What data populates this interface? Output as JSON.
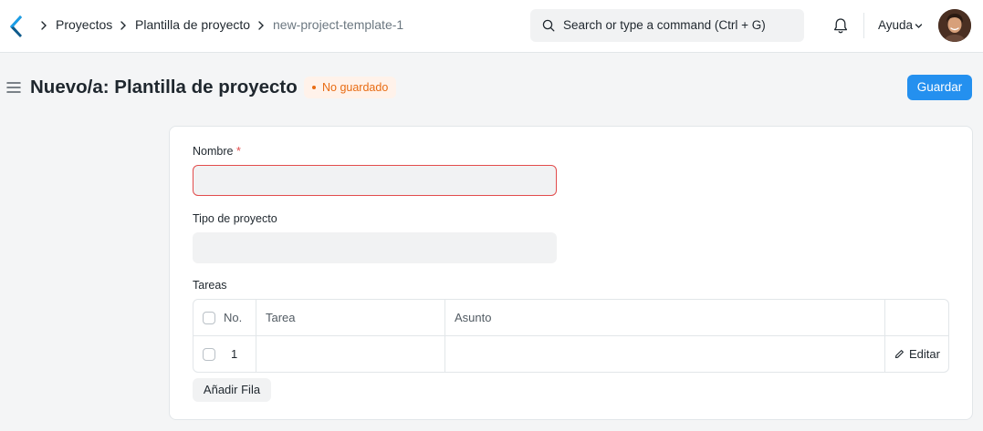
{
  "navbar": {
    "breadcrumbs": [
      "Proyectos",
      "Plantilla de proyecto",
      "new-project-template-1"
    ],
    "search_placeholder": "Search or type a command (Ctrl + G)",
    "help_label": "Ayuda"
  },
  "page": {
    "title": "Nuevo/a: Plantilla de proyecto",
    "status": "No guardado",
    "save_label": "Guardar"
  },
  "form": {
    "name_label": "Nombre",
    "required_mark": "*",
    "name_value": "",
    "project_type_label": "Tipo de proyecto",
    "project_type_value": "",
    "tasks_label": "Tareas",
    "table": {
      "headers": [
        "No.",
        "Tarea",
        "Asunto"
      ],
      "rows": [
        {
          "no": "1",
          "task": "",
          "subject": "",
          "edit_label": "Editar"
        }
      ]
    },
    "add_row_label": "Añadir Fila"
  },
  "colors": {
    "primary": "#2490ef",
    "unsaved_text": "#e86c13",
    "unsaved_bg": "#fff2ea",
    "error": "#e24c4c"
  }
}
